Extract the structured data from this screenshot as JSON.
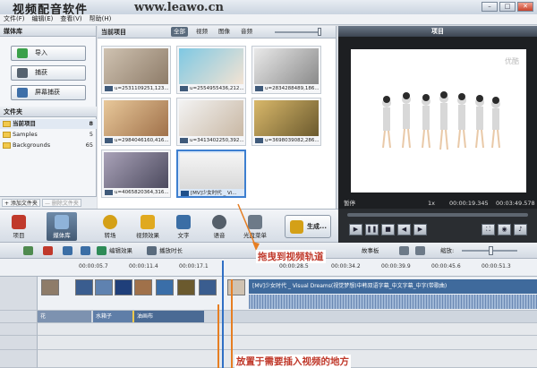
{
  "app": {
    "title": "视频配音软件",
    "url": "www.leawo.cn",
    "menu": [
      "文件(F)",
      "编辑(E)",
      "查看(V)",
      "帮助(H)"
    ]
  },
  "library": {
    "title": "媒体库",
    "buttons": [
      "导入",
      "捕获",
      "屏幕捕获"
    ],
    "folders_title": "文件夹",
    "folders": [
      {
        "name": "当前项目",
        "count": "8"
      },
      {
        "name": "Samples",
        "count": "5"
      },
      {
        "name": "Backgrounds",
        "count": "65"
      }
    ],
    "add_folder": "+ 添加文件夹",
    "delete_folder": "— 删除文件夹"
  },
  "media": {
    "title": "当前项目",
    "tabs": [
      "全部",
      "视频",
      "图像",
      "音频"
    ],
    "active_tab": "全部",
    "items": [
      {
        "caption": "u=2531109251,123..."
      },
      {
        "caption": "u=2554955436,212..."
      },
      {
        "caption": "u=2834288489,186..."
      },
      {
        "caption": "u=2984046160,416..."
      },
      {
        "caption": "u=3413402250,392..."
      },
      {
        "caption": "u=3698039082,286..."
      },
      {
        "caption": "u=4065820364,316..."
      },
      {
        "caption": "[MV]少女时代 _ Vi..."
      }
    ]
  },
  "preview": {
    "title": "项目",
    "watermark": "优酷",
    "state": "暂停",
    "speed": "1x",
    "time_current": "00:00:19.345",
    "time_total": "00:03:49.578"
  },
  "toolbar": {
    "items": [
      "项目",
      "媒体库",
      "转场",
      "视频效果",
      "文字",
      "语音",
      "光盘菜单"
    ],
    "active": "媒体库",
    "produce": "生成..."
  },
  "timeline": {
    "edit_effects": "编辑效果",
    "play_duration": "播放时长",
    "storyboard": "故事板",
    "zoom_label": "缩放:",
    "ruler": [
      "00:00:05.7",
      "00:00:11.4",
      "00:00:17.1",
      "00:00:28.5",
      "00:00:34.2",
      "00:00:39.9",
      "00:00:45.6",
      "00:00:51.3"
    ],
    "video_clip_label": "[MV]少女时代 _ Visual Dreams(视觉梦想)中韩双语字幕_中文字幕_中字(带歌曲)",
    "overlay_clips": [
      "花",
      "水箱子",
      "油画布"
    ]
  },
  "annotations": {
    "drag": "拖曳到视频轨道",
    "place": "放置于需要插入视频的地方"
  },
  "colors": {
    "accent": "#3d7fd0",
    "annotation": "#c0392b",
    "marker": "#e67e22"
  }
}
